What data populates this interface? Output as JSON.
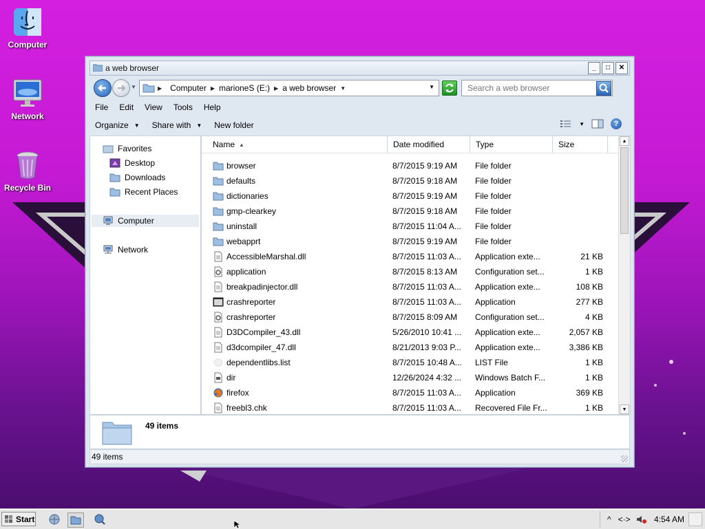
{
  "desktop": {
    "icons": [
      {
        "label": "Computer",
        "icon": "finder-computer-icon"
      },
      {
        "label": "Network",
        "icon": "imac-network-icon"
      },
      {
        "label": "Recycle Bin",
        "icon": "recycle-bin-icon"
      }
    ]
  },
  "window": {
    "title": "a web browser",
    "controls": {
      "minimize": "_",
      "maximize": "□",
      "close": "✕"
    },
    "address": {
      "crumbs": [
        "Computer",
        "marioneS (E:)",
        "a web browser"
      ],
      "search_placeholder": "Search a web browser"
    },
    "menu": [
      "File",
      "Edit",
      "View",
      "Tools",
      "Help"
    ],
    "commands": {
      "organize": "Organize",
      "share": "Share with",
      "new_folder": "New folder",
      "help": "?"
    },
    "nav": {
      "favorites": "Favorites",
      "desktop": "Desktop",
      "downloads": "Downloads",
      "recent": "Recent Places",
      "computer": "Computer",
      "network": "Network"
    },
    "columns": {
      "name": "Name",
      "date": "Date modified",
      "type": "Type",
      "size": "Size"
    },
    "files": [
      {
        "name": "browser",
        "date": "8/7/2015 9:19 AM",
        "type": "File folder",
        "size": "",
        "icon": "folder"
      },
      {
        "name": "defaults",
        "date": "8/7/2015 9:18 AM",
        "type": "File folder",
        "size": "",
        "icon": "folder"
      },
      {
        "name": "dictionaries",
        "date": "8/7/2015 9:19 AM",
        "type": "File folder",
        "size": "",
        "icon": "folder"
      },
      {
        "name": "gmp-clearkey",
        "date": "8/7/2015 9:18 AM",
        "type": "File folder",
        "size": "",
        "icon": "folder"
      },
      {
        "name": "uninstall",
        "date": "8/7/2015 11:04 A...",
        "type": "File folder",
        "size": "",
        "icon": "folder"
      },
      {
        "name": "webapprt",
        "date": "8/7/2015 9:19 AM",
        "type": "File folder",
        "size": "",
        "icon": "folder"
      },
      {
        "name": "AccessibleMarshal.dll",
        "date": "8/7/2015 11:03 A...",
        "type": "Application exte...",
        "size": "21 KB",
        "icon": "dll"
      },
      {
        "name": "application",
        "date": "8/7/2015 8:13 AM",
        "type": "Configuration set...",
        "size": "1 KB",
        "icon": "config"
      },
      {
        "name": "breakpadinjector.dll",
        "date": "8/7/2015 11:03 A...",
        "type": "Application exte...",
        "size": "108 KB",
        "icon": "dll"
      },
      {
        "name": "crashreporter",
        "date": "8/7/2015 11:03 A...",
        "type": "Application",
        "size": "277 KB",
        "icon": "app"
      },
      {
        "name": "crashreporter",
        "date": "8/7/2015 8:09 AM",
        "type": "Configuration set...",
        "size": "4 KB",
        "icon": "config"
      },
      {
        "name": "D3DCompiler_43.dll",
        "date": "5/26/2010 10:41 ...",
        "type": "Application exte...",
        "size": "2,057 KB",
        "icon": "dll"
      },
      {
        "name": "d3dcompiler_47.dll",
        "date": "8/21/2013 9:03 P...",
        "type": "Application exte...",
        "size": "3,386 KB",
        "icon": "dll"
      },
      {
        "name": "dependentlibs.list",
        "date": "8/7/2015 10:48 A...",
        "type": "LIST File",
        "size": "1 KB",
        "icon": "blank"
      },
      {
        "name": "dir",
        "date": "12/26/2024 4:32 ...",
        "type": "Windows Batch F...",
        "size": "1 KB",
        "icon": "batch"
      },
      {
        "name": "firefox",
        "date": "8/7/2015 11:03 A...",
        "type": "Application",
        "size": "369 KB",
        "icon": "firefox"
      },
      {
        "name": "freebl3.chk",
        "date": "8/7/2015 11:03 A...",
        "type": "Recovered File Fr...",
        "size": "1 KB",
        "icon": "dll"
      }
    ],
    "details": {
      "count": "49 items"
    },
    "status": {
      "count": "49 items"
    }
  },
  "taskbar": {
    "start": "Start",
    "tray": {
      "time": "4:54 AM",
      "chevron": "^",
      "network": "<·>"
    }
  }
}
